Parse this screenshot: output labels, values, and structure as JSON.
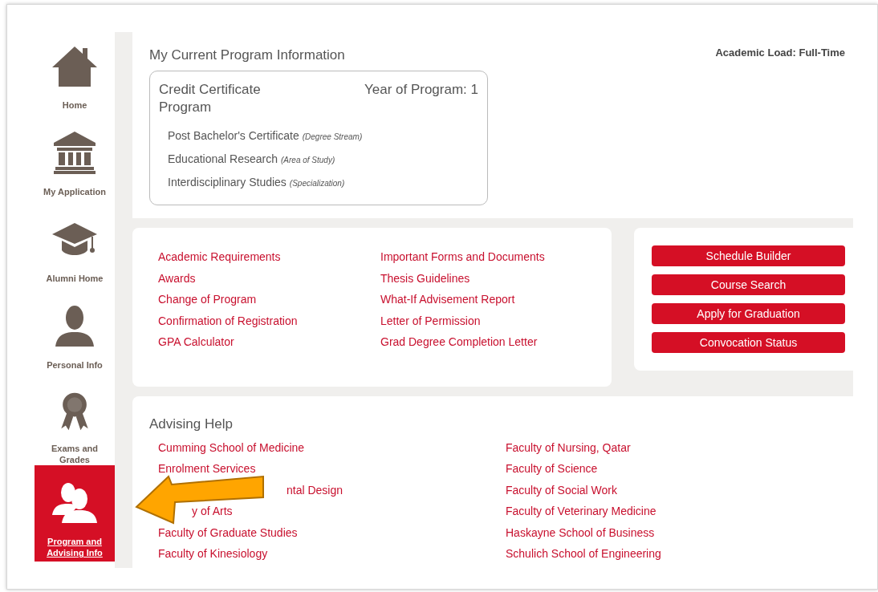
{
  "sidebar": {
    "items": [
      {
        "label": "Home",
        "selected": false
      },
      {
        "label": "My Application",
        "selected": false
      },
      {
        "label": "Alumni Home",
        "selected": false
      },
      {
        "label": "Personal Info",
        "selected": false
      },
      {
        "label": "Exams and Grades",
        "selected": false
      },
      {
        "label": "Program and Advising Info",
        "selected": true
      }
    ]
  },
  "program": {
    "title": "My Current Program Information",
    "academic_load": "Academic Load: Full-Time",
    "name": "Credit Certificate Program",
    "year": "Year of Program: 1",
    "details": [
      {
        "value": "Post Bachelor's Certificate",
        "note": "(Degree Stream)"
      },
      {
        "value": "Educational Research",
        "note": "(Area of Study)"
      },
      {
        "value": "Interdisciplinary Studies",
        "note": "(Specialization)"
      }
    ]
  },
  "links": {
    "columns": [
      [
        "Academic Requirements",
        "Awards",
        "Change of Program",
        "Confirmation of Registration",
        "GPA Calculator"
      ],
      [
        "Important Forms and Documents",
        "Thesis Guidelines",
        "What-If Advisement Report",
        "Letter of Permission",
        "Grad Degree Completion Letter"
      ]
    ]
  },
  "buttons": [
    "Schedule Builder",
    "Course Search",
    "Apply for Graduation",
    "Convocation Status"
  ],
  "advising": {
    "title": "Advising Help",
    "columns": [
      [
        {
          "label": "Cumming School of Medicine",
          "kind": "whole"
        },
        {
          "label": "Enrolment Services",
          "kind": "whole"
        },
        {
          "label": "ntal Design",
          "kind": "tail_long"
        },
        {
          "label": "y of Arts",
          "kind": "tail_short"
        },
        {
          "label": "Faculty of Graduate Studies",
          "kind": "whole"
        },
        {
          "label": "Faculty of Kinesiology",
          "kind": "whole"
        }
      ],
      [
        {
          "label": "Faculty of Nursing, Qatar",
          "kind": "whole"
        },
        {
          "label": "Faculty of Science",
          "kind": "whole"
        },
        {
          "label": "Faculty of Social Work",
          "kind": "whole"
        },
        {
          "label": "Faculty of Veterinary Medicine",
          "kind": "whole"
        },
        {
          "label": "Haskayne School of Business",
          "kind": "whole"
        },
        {
          "label": "Schulich School of Engineering",
          "kind": "whole"
        }
      ]
    ]
  }
}
